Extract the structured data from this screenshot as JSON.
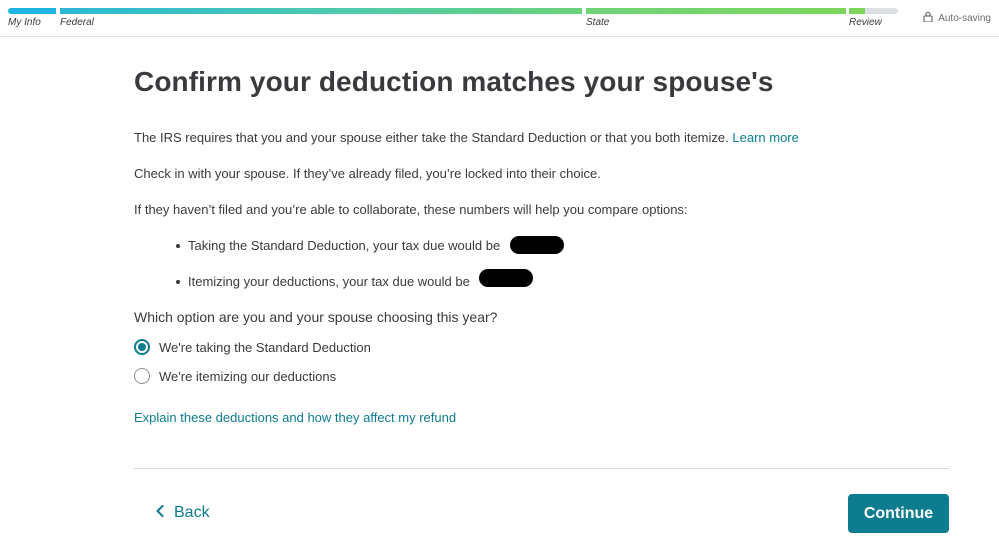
{
  "progress": {
    "steps": {
      "my_info": "My Info",
      "federal": "Federal",
      "state": "State",
      "review": "Review"
    },
    "status_text": "Auto-saving",
    "icons": {
      "status": "lock-icon"
    },
    "colors": {
      "myinfo": "#20b4e3",
      "federal_start": "#2bb8d6",
      "state": "#7cd65a",
      "incomplete": "#dcdfe3"
    }
  },
  "page": {
    "title": "Confirm your deduction matches your spouse's",
    "intro_text": "The IRS requires that you and your spouse either take the Standard Deduction or that you both itemize.",
    "learn_more_label": "Learn more",
    "check_text": "Check in with your spouse. If they’ve already filed, you’re locked into their choice.",
    "compare_text": "If they haven’t filed and you’re able to collaborate, these numbers will help you compare options:",
    "bullets": [
      "Taking the Standard Deduction, your tax due would be",
      "Itemizing your deductions, your tax due would be"
    ],
    "question": "Which option are you and your spouse choosing this year?",
    "options": [
      {
        "label": "We're taking the Standard Deduction",
        "selected": true
      },
      {
        "label": "We're itemizing our deductions",
        "selected": false
      }
    ],
    "explain_link": "Explain these deductions and how they affect my refund"
  },
  "footer": {
    "back_label": "Back",
    "continue_label": "Continue",
    "icons": {
      "back": "chevron-left-icon"
    },
    "colors": {
      "primary": "#0d7c8f"
    }
  }
}
